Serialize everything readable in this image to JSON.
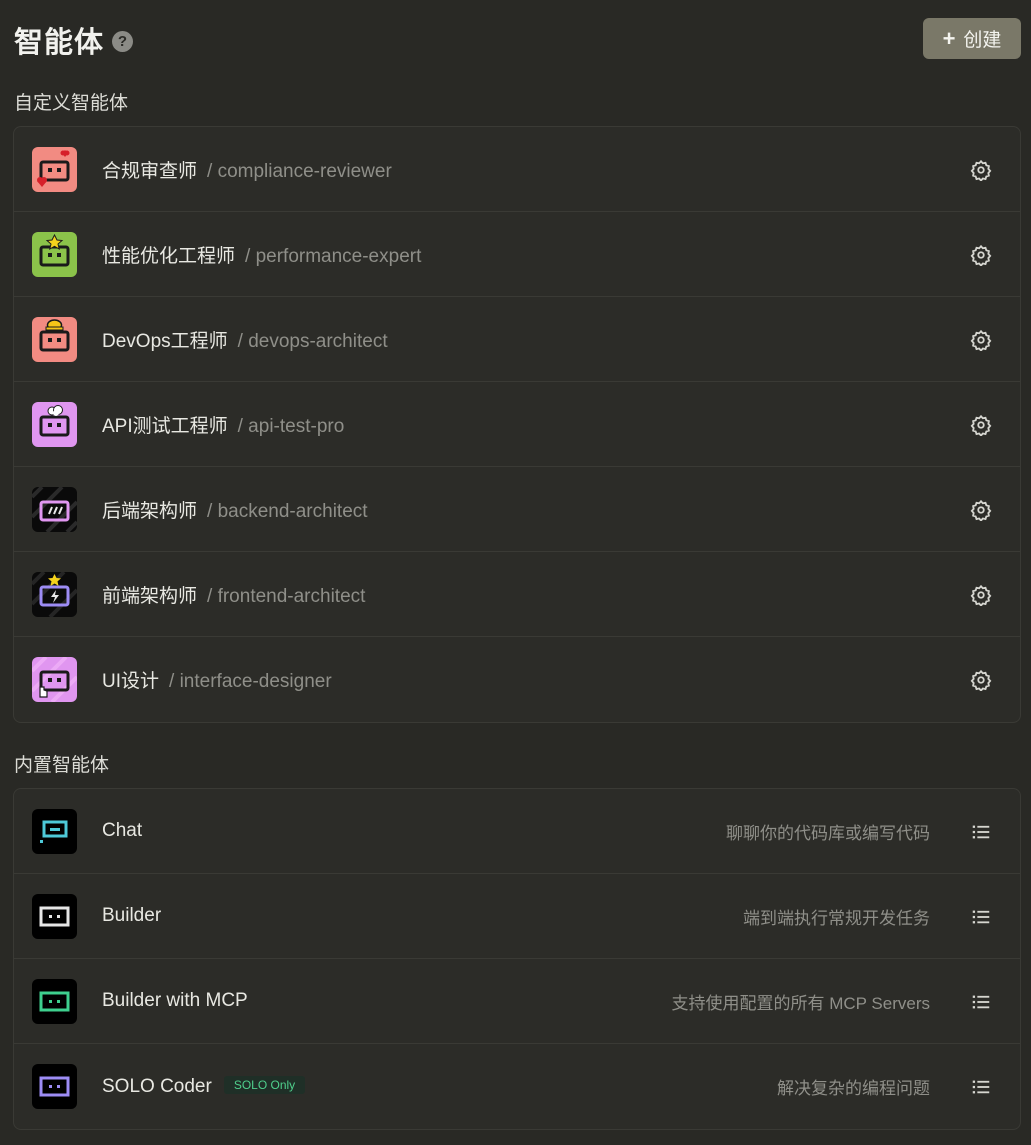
{
  "header": {
    "title": "智能体",
    "help_icon": "question-circle-icon",
    "create_label": "创建",
    "create_icon": "plus-icon",
    "create_button_color": "#7a7868"
  },
  "custom": {
    "section_title": "自定义智能体",
    "items": [
      {
        "name": "合规审查师",
        "id": "/ compliance-reviewer",
        "avatar_color": "#f28b82",
        "avatar_icon": "robot-heart-icon",
        "action_icon": "gear-icon"
      },
      {
        "name": "性能优化工程师",
        "id": "/ performance-expert",
        "avatar_color": "#8bc34a",
        "avatar_icon": "robot-star-icon",
        "action_icon": "gear-icon"
      },
      {
        "name": "DevOps工程师",
        "id": "/ devops-architect",
        "avatar_color": "#f28b82",
        "avatar_icon": "robot-hat-icon",
        "action_icon": "gear-icon"
      },
      {
        "name": "API测试工程师",
        "id": "/ api-test-pro",
        "avatar_color": "#e096f0",
        "avatar_icon": "robot-cloud-icon",
        "action_icon": "gear-icon"
      },
      {
        "name": "后端架构师",
        "id": "/ backend-architect",
        "avatar_color": "#000000",
        "avatar_icon": "robot-code-icon",
        "action_icon": "gear-icon"
      },
      {
        "name": "前端架构师",
        "id": "/ frontend-architect",
        "avatar_color": "#000000",
        "avatar_icon": "robot-lightning-icon",
        "action_icon": "gear-icon"
      },
      {
        "name": "UI设计",
        "id": "/ interface-designer",
        "avatar_color": "#e096f0",
        "avatar_icon": "robot-cursor-icon",
        "action_icon": "gear-icon"
      }
    ]
  },
  "builtin": {
    "section_title": "内置智能体",
    "items": [
      {
        "name": "Chat",
        "description": "聊聊你的代码库或编写代码",
        "avatar_color": "#000000",
        "accent": "#4ec9d8",
        "avatar_icon": "chat-bot-icon",
        "action_icon": "list-icon"
      },
      {
        "name": "Builder",
        "description": "端到端执行常规开发任务",
        "avatar_color": "#000000",
        "accent": "#e6e6e6",
        "avatar_icon": "builder-bot-icon",
        "action_icon": "list-icon"
      },
      {
        "name": "Builder with MCP",
        "description": "支持使用配置的所有 MCP Servers",
        "avatar_color": "#000000",
        "accent": "#3ecf8e",
        "avatar_icon": "mcp-bot-icon",
        "action_icon": "list-icon"
      },
      {
        "name": "SOLO Coder",
        "badge": "SOLO Only",
        "description": "解决复杂的编程问题",
        "avatar_color": "#000000",
        "accent": "#9d8cf5",
        "avatar_icon": "solo-bot-icon",
        "action_icon": "list-icon"
      }
    ]
  }
}
